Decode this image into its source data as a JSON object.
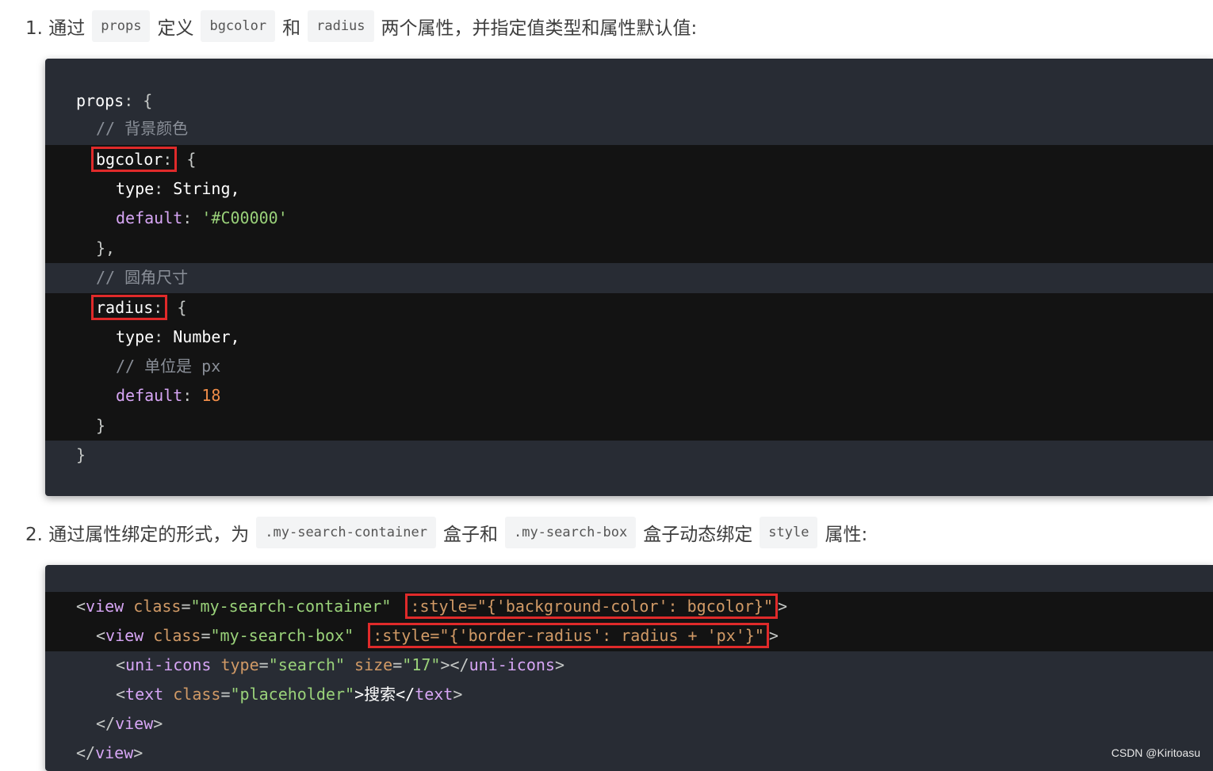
{
  "step1": {
    "prefix": "1. 通过",
    "code1": "props",
    "mid1": "定义",
    "code2": "bgcolor",
    "mid2": "和",
    "code3": "radius",
    "suffix": "两个属性，并指定值类型和属性默认值:"
  },
  "code1": {
    "l1_key": "props",
    "l1_rest": ": {",
    "l2_comment": "// 背景颜色",
    "l3_key": "bgcolor",
    "l3_colon": ":",
    "l3_rest": " {",
    "l4_key": "type",
    "l4_colon": ": ",
    "l4_val": "String,",
    "l5_key": "default",
    "l5_colon": ": ",
    "l5_val": "'#C00000'",
    "l6": "},",
    "l7_comment": "// 圆角尺寸",
    "l8_key": "radius",
    "l8_colon": ":",
    "l8_rest": " {",
    "l9_key": "type",
    "l9_colon": ": ",
    "l9_val": "Number,",
    "l10_comment": "// 单位是 px",
    "l11_key": "default",
    "l11_colon": ": ",
    "l11_val": "18",
    "l12": "}",
    "l13": "}"
  },
  "step2": {
    "prefix": "2. 通过属性绑定的形式，为",
    "code1": ".my-search-container",
    "mid1": "盒子和",
    "code2": ".my-search-box",
    "mid2": "盒子动态绑定",
    "code3": "style",
    "suffix": "属性:"
  },
  "code2": {
    "l1_open": "<",
    "l1_tag": "view",
    "l1_attr": " class",
    "l1_eq": "=",
    "l1_str": "\"my-search-container\"",
    "l1_hl": ":style=\"{'background-color': bgcolor}\"",
    "l1_close": ">",
    "l2_open": "<",
    "l2_tag": "view",
    "l2_attr": " class",
    "l2_eq": "=",
    "l2_str": "\"my-search-box\"",
    "l2_hl": ":style=\"{'border-radius': radius + 'px'}\"",
    "l2_close": ">",
    "l3_open": "<",
    "l3_tag": "uni-icons",
    "l3_attr1": " type",
    "l3_str1": "\"search\"",
    "l3_attr2": " size",
    "l3_str2": "\"17\"",
    "l3_end": "></",
    "l3_tag2": "uni-icons",
    "l3_close": ">",
    "l4_open": "<",
    "l4_tag": "text",
    "l4_attr": " class",
    "l4_str": "\"placeholder\"",
    "l4_text": ">搜索</",
    "l4_tag2": "text",
    "l4_close": ">",
    "l5_open": "</",
    "l5_tag": "view",
    "l5_close": ">",
    "l6_open": "</",
    "l6_tag": "view",
    "l6_close": ">"
  },
  "watermark": "CSDN @Kiritoasu"
}
